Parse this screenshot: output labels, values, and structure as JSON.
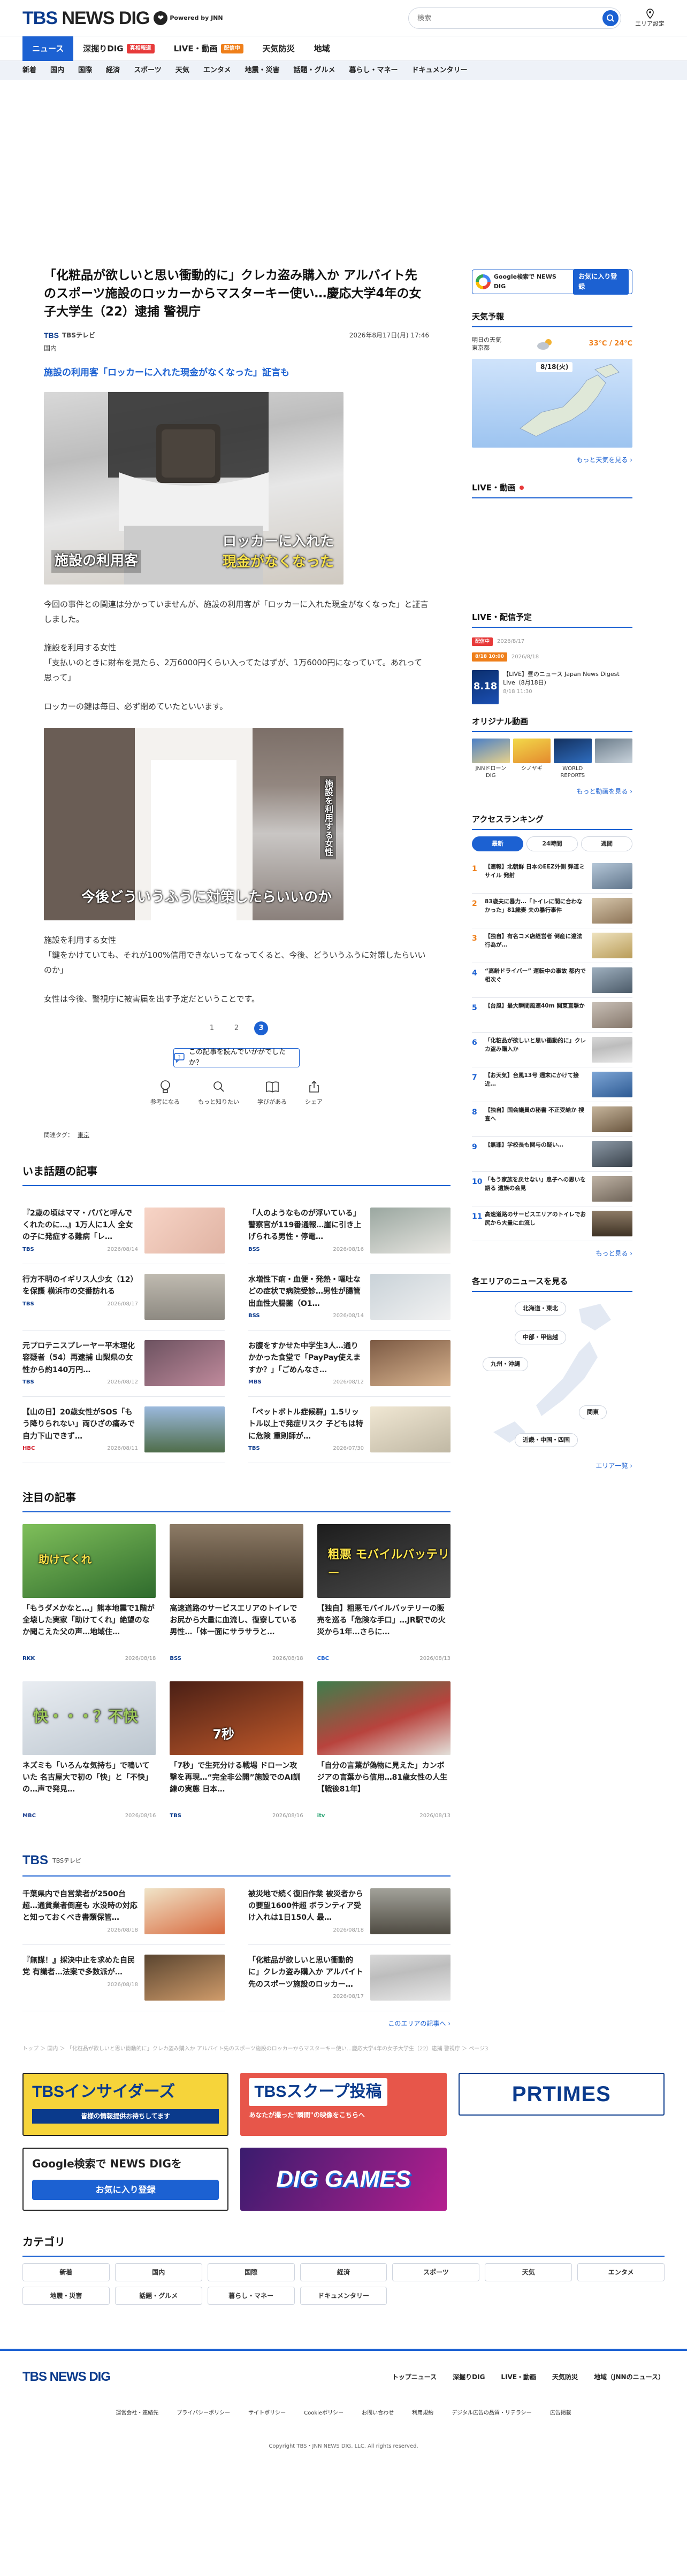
{
  "header": {
    "logo": "TBS NEWS DIG",
    "powered": "Powered by JNN",
    "search_placeholder": "検索",
    "area_label": "エリア設定"
  },
  "main_nav": [
    {
      "label": "ニュース"
    },
    {
      "label": "深掘りDIG",
      "badge": "真相報道"
    },
    {
      "label": "LIVE・動画",
      "badge": "配信中"
    },
    {
      "label": "天気防災"
    },
    {
      "label": "地域"
    }
  ],
  "sub_nav": [
    "新着",
    "国内",
    "国際",
    "経済",
    "スポーツ",
    "天気",
    "エンタメ",
    "地震・災害",
    "話題・グルメ",
    "暮らし・マネー",
    "ドキュメンタリー"
  ],
  "article": {
    "title": "「化粧品が欲しいと思い衝動的に」クレカ盗み購入か アルバイト先のスポーツ施設のロッカーからマスターキー使い…慶応大学4年の女子大学生（22）逮捕 警視庁",
    "source": "TBSテレビ",
    "source_logo": "TBS",
    "date": "2026年8月17日(月) 17:46",
    "category": "国内",
    "heading": "施設の利用客「ロッカーに入れた現金がなくなった」証言も",
    "photo1_caption_left": "施設の利用客",
    "photo1_caption_right_1": "ロッカーに入れた",
    "photo1_caption_right_2": "現金がなくなった",
    "para1": "今回の事件との関連は分かっていませんが、施設の利用客が「ロッカーに入れた現金がなくなった」と証言しました。",
    "quote1_label": "施設を利用する女性",
    "quote1_text": "「支払いのときに財布を見たら、2万6000円くらい入ってたはずが、1万6000円になっていて。あれって思って」",
    "para2": "ロッカーの鍵は毎日、必ず閉めていたといいます。",
    "photo2_caption": "今後どういうふうに対策したらいいのか",
    "photo2_vertical": "施設を利用する女性",
    "quote2_label": "施設を利用する女性",
    "quote2_text": "「鍵をかけていても、それが100%信用できないってなってくると、今後、どういうふうに対策したらいいのか」",
    "para3": "女性は今後、警視庁に被害届を出す予定だということです。",
    "pages": [
      "1",
      "2",
      "3"
    ],
    "question_btn": "この記事を読んでいかがでしたか？",
    "reactions": [
      "参考になる",
      "もっと知りたい",
      "学びがある",
      "シェア"
    ],
    "tag_label": "関連タグ：",
    "tag": "東京"
  },
  "trending": {
    "title": "いま話題の記事",
    "items": [
      {
        "title": "『2歳の頃はママ・パパと呼んでくれたのに…』1万人に1人 全女の子に発症する難病「レ…",
        "source": "TBS",
        "date": "2026/08/14"
      },
      {
        "title": "「人のようなものが浮いている」警察官が119番通報…崖に引き上げられる男性・停電…",
        "source": "BSS",
        "date": "2026/08/16"
      },
      {
        "title": "行方不明のイギリス人少女（12）を保護 横浜市の交番訪れる",
        "source": "TBS",
        "date": "2026/08/17"
      },
      {
        "title": "水増性下痢・血便・発熱・嘔吐などの症状で病院受診…男性が腸管出血性大腸菌（O1…",
        "source": "BSS",
        "date": "2026/08/14"
      },
      {
        "title": "元プロテニスプレーヤー平木理化容疑者（54）再逮捕 山梨県の女性から約140万円…",
        "source": "TBS",
        "date": "2026/08/12"
      },
      {
        "title": "お腹をすかせた中学生3人…通りかかった食堂で「PayPay使えますか？」「ごめんなさ…",
        "source": "MBS",
        "date": "2026/08/12"
      },
      {
        "title": "【山の日】20歳女性がSOS「もう降りられない」両ひざの痛みで自力下山できず…",
        "source": "HBC",
        "date": "2026/08/11"
      },
      {
        "title": "「ペットボトル症候群」1.5リットル以上で発症リスク 子どもは特に危険 重則師が…",
        "source": "TBS",
        "date": "2026/07/30"
      }
    ]
  },
  "featured": {
    "title": "注目の記事",
    "items": [
      {
        "title": "「もうダメかなと…」熊本地震で1階が全壊した実家「助けてくれ」絶望のなか聞こえた父の声…地域住…",
        "source": "RKK",
        "date": "2026/08/18",
        "img": "助けてくれ"
      },
      {
        "title": "高速道路のサービスエリアのトイレでお尻から大量に血流し、復寮している男性…「体一面にサラサラと…",
        "source": "BSS",
        "date": "2026/08/18",
        "img": ""
      },
      {
        "title": "【独自】粗悪モバイルバッテリーの販売を巡る「危険な手口」…JR駅での火災から1年…さらに…",
        "source": "CBC",
        "date": "2026/08/13",
        "img": "粗悪 モバイルバッテリー"
      },
      {
        "title": "ネズミも「いろんな気持ち」で鳴いていた 名古屋大で初の「快」と「不快」の…声で発見…",
        "source": "MBC",
        "date": "2026/08/16",
        "img": "快・・・？不快"
      },
      {
        "title": "「7秒」で生死分ける戦場 ドローン攻撃を再現…“完全非公開”施設でのAI訓練の実態 日本…",
        "source": "TBS",
        "date": "2026/08/16",
        "img": "7秒"
      },
      {
        "title": "「自分の言葉が偽物に見えた」カンボジアの言葉から信用…81歳女性の人生【戦後81年】",
        "source": "itv",
        "date": "2026/08/13",
        "img": ""
      }
    ]
  },
  "tbs_section": {
    "title": "TBS",
    "subtitle": "TBSテレビ",
    "items": [
      {
        "title": "千葉県内で自営業者が2500台超…通貨業者倒産も 水没時の対応と知っておくべき書類保管…",
        "date": "2026/08/18"
      },
      {
        "title": "被災地で続く復旧作業 被災者からの要望1600件超 ボランティア受け入れは1日150人 最…",
        "date": "2026/08/18"
      },
      {
        "title": "『無謀！』採決中止を求めた自民党 有識者…法案で多数派が…",
        "date": "2026/08/18"
      },
      {
        "title": "「化粧品が欲しいと思い衝動的に」クレカ盗み購入か アルバイト先のスポーツ施設のロッカー…",
        "date": "2026/08/17"
      }
    ],
    "more": "このエリアの記事へ"
  },
  "breadcrumb": "トップ ＞ 国内 ＞ 「化粧品が欲しいと思い衝動的に」クレカ盗み購入か アルバイト先のスポーツ施設のロッカーからマスターキー使い…慶応大学4年の女子大学生（22）逮捕 警視庁 ＞ ページ3",
  "banners": [
    {
      "text": "TBSインサイダーズ",
      "sub": "皆様の情報提供お待ちしてます"
    },
    {
      "text": "TBSスクープ投稿",
      "sub": "あなたが撮った\"瞬間\"の映像をこちらへ"
    },
    {
      "text": "PRTIMES",
      "sub": ""
    },
    {
      "text": "Google検索で NEWS DIGを",
      "sub": "お気に入り登録"
    },
    {
      "text": "DIG GAMES",
      "sub": ""
    }
  ],
  "categories": {
    "title": "カテゴリ",
    "items": [
      "新着",
      "国内",
      "国際",
      "経済",
      "スポーツ",
      "天気",
      "エンタメ",
      "地震・災害",
      "話題・グルメ",
      "暮らし・マネー",
      "ドキュメンタリー"
    ]
  },
  "aside": {
    "google_label": "Google検索で NEWS DIG",
    "google_btn": "お気に入り登録",
    "weather_title": "天気予報",
    "weather_place_1": "明日の天気",
    "weather_place_2": "東京都",
    "weather_temp": "33℃ / 24℃",
    "weather_date": "8/18(火)",
    "weather_more": "もっと天気を見る",
    "live_title": "LIVE・動画",
    "live_delivery_title": "LIVE・配信予定",
    "live_items": [
      {
        "label": "配信中",
        "date": "2026/8/17"
      },
      {
        "label": "8/18 10:00",
        "date": "2026/8/18"
      }
    ],
    "live_card_title": "【LIVE】昼のニュース Japan News Digest Live（8月18日）",
    "live_card_time": "8/18 11:30",
    "original_title": "オリジナル動画",
    "originals": [
      "JNNドローンDIG",
      "シノヤギ",
      "WORLD REPORTS",
      ""
    ],
    "originals_more": "もっと動画を見る",
    "ranking_title": "アクセスランキング",
    "ranking_tabs": [
      "最新",
      "24時間",
      "週間"
    ],
    "ranking": [
      {
        "t": "【速報】北朝鮮 日本のEEZ外側 弾道ミサイル 発射"
      },
      {
        "t": "83歳夫に暴力…「トイレに間に合わなかった」81歳妻 夫の暴行事件"
      },
      {
        "t": "【独自】有名コメ店経営者 倒産に違法行為が…"
      },
      {
        "t": "“高齢ドライバー” 運転中の事故 都内で相次ぐ"
      },
      {
        "t": "【台風】最大瞬間風速40m 関東直撃か"
      },
      {
        "t": "「化粧品が欲しいと思い衝動的に」クレカ盗み購入か"
      },
      {
        "t": "【お天気】台風13号 週末にかけて接近…"
      },
      {
        "t": "【独自】国会議員の秘書 不正受給か 捜査へ"
      },
      {
        "t": "【無罪】学校長も関与の疑い…"
      },
      {
        "t": "「もう家族を戻せない」息子への思いを語る 遺族の会見"
      },
      {
        "t": "高速道路のサービスエリアのトイレでお尻から大量に血流し"
      }
    ],
    "ranking_more": "もっと見る",
    "area_title": "各エリアのニュースを見る",
    "areas": [
      "北海道・東北",
      "中部・甲信越",
      "九州・沖縄",
      "関東",
      "近畿・中国・四国"
    ],
    "area_more": "エリア一覧"
  },
  "footer": {
    "logo": "TBS NEWS DIG",
    "nav": [
      "トップニュース",
      "深掘りDIG",
      "LIVE・動画",
      "天気防災",
      "地域（JNNのニュース）"
    ],
    "links": [
      "運営会社・連絡先",
      "プライバシーポリシー",
      "サイトポリシー",
      "Cookieポリシー",
      "お問い合わせ",
      "利用規約",
      "デジタル広告の品質・リテラシー",
      "広告掲載"
    ],
    "copyright": "Copyright TBS・JNN NEWS DIG, LLC. All rights reserved."
  },
  "colors": {
    "brand": "#0a3a8c",
    "accent": "#1c61d2",
    "live": "#e73a3a",
    "rank_top": "#ef7f1a"
  }
}
